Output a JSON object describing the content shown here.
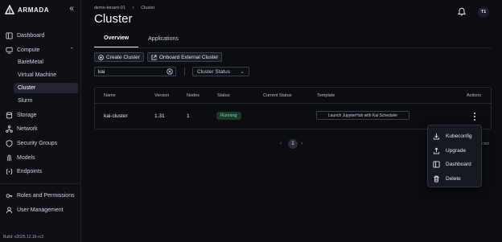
{
  "app": {
    "brand": "ARMADA",
    "build": "Build: v2025.12.16-rc3"
  },
  "sidebar": {
    "items": [
      {
        "label": "Dashboard",
        "icon": "dashboard-icon"
      },
      {
        "label": "Compute",
        "icon": "compute-icon",
        "expanded": true
      },
      {
        "label": "Storage",
        "icon": "storage-icon"
      },
      {
        "label": "Network",
        "icon": "network-icon"
      },
      {
        "label": "Security Groups",
        "icon": "shield-icon"
      },
      {
        "label": "Models",
        "icon": "models-icon"
      },
      {
        "label": "Endpoints",
        "icon": "endpoints-icon"
      },
      {
        "label": "Roles and Permissions",
        "icon": "key-icon"
      },
      {
        "label": "User Management",
        "icon": "user-icon"
      }
    ],
    "compute_sub": [
      {
        "label": "BareMetal"
      },
      {
        "label": "Virtual Machine"
      },
      {
        "label": "Cluster",
        "active": true
      },
      {
        "label": "Slurm"
      }
    ]
  },
  "header": {
    "breadcrumb": [
      "demo-tenant-01",
      "Cluster"
    ],
    "breadcrumb_sep": ">",
    "title": "Cluster",
    "avatar": "T1"
  },
  "tabs": [
    {
      "label": "Overview",
      "active": true
    },
    {
      "label": "Applications",
      "active": false
    }
  ],
  "toolbar": {
    "create_label": "Create Cluster",
    "onboard_label": "Onboard External Cluster"
  },
  "filters": {
    "search_value": "kai",
    "status_placeholder": "Cluster Status"
  },
  "table": {
    "columns": [
      "Name",
      "Version",
      "Nodes",
      "Status",
      "Current Status",
      "Template",
      "Actions"
    ],
    "rows": [
      {
        "name": "kai-cluster",
        "version": "1.31",
        "nodes": "1",
        "status": "Running",
        "current_status": "",
        "template": "Launch JupyterHub with Kai Scheduler"
      }
    ]
  },
  "pagination": {
    "page": "1",
    "partial_text": "own"
  },
  "actions_menu": [
    {
      "label": "Kubeconfig",
      "icon": "download-icon"
    },
    {
      "label": "Upgrade",
      "icon": "upload-icon"
    },
    {
      "label": "Dashboard",
      "icon": "dashboard-icon"
    },
    {
      "label": "Delete",
      "icon": "trash-icon"
    }
  ],
  "colors": {
    "background": "#0b0d12",
    "status_running_bg": "#1b3a2a",
    "status_running_text": "#6fe0a0"
  }
}
